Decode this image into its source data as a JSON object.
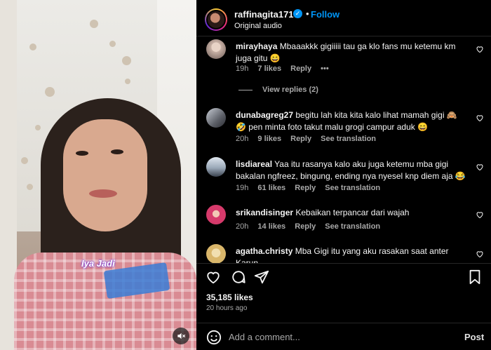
{
  "header": {
    "username": "raffinagita1717",
    "verified_icon": "verified-badge-icon",
    "separator": "•",
    "follow_label": "Follow",
    "audio": "Original audio"
  },
  "video": {
    "caption": "Iya Jadi",
    "mute_icon": "speaker-muted-icon"
  },
  "comments": [
    {
      "username": "mirayhaya",
      "text": "Mbaaakkk gigiiiii tau ga klo fans mu ketemu km juga gitu 😄",
      "time": "19h",
      "likes": "7 likes",
      "reply": "Reply",
      "more": "•••",
      "avatar_color": "#c9b2a6"
    },
    {
      "username": "dunabagreg27",
      "text": "begitu lah kita kita kalo lihat mamah gigi 🙈🤣 pen minta foto takut malu grogi campur aduk 😄",
      "time": "20h",
      "likes": "9 likes",
      "reply": "Reply",
      "translation": "See translation",
      "avatar_color": "#7d7f87"
    },
    {
      "username": "lisdiareal",
      "text": "Yaa itu rasanya kalo aku juga ketemu mba gigi bakalan ngfreez, bingung, ending nya nyesel knp diem aja 😂",
      "time": "19h",
      "likes": "61 likes",
      "reply": "Reply",
      "translation": "See translation",
      "avatar_color": "#9aa8b8"
    },
    {
      "username": "srikandisinger",
      "text": "Kebaikan terpancar dari wajah",
      "time": "20h",
      "likes": "14 likes",
      "reply": "Reply",
      "translation": "See translation",
      "avatar_color": "#d63a6b"
    },
    {
      "username": "agatha.christy",
      "text": "Mba Gigi itu yang aku rasakan saat anter Karun",
      "avatar_color": "#d9b66a"
    }
  ],
  "view_replies": "View replies (2)",
  "actions": {
    "like_icon": "heart-icon",
    "comment_icon": "comment-icon",
    "share_icon": "share-icon",
    "save_icon": "bookmark-icon"
  },
  "likes": "35,185 likes",
  "posted": "20 hours ago",
  "composer": {
    "emoji_icon": "emoji-icon",
    "placeholder": "Add a comment...",
    "post_label": "Post"
  }
}
